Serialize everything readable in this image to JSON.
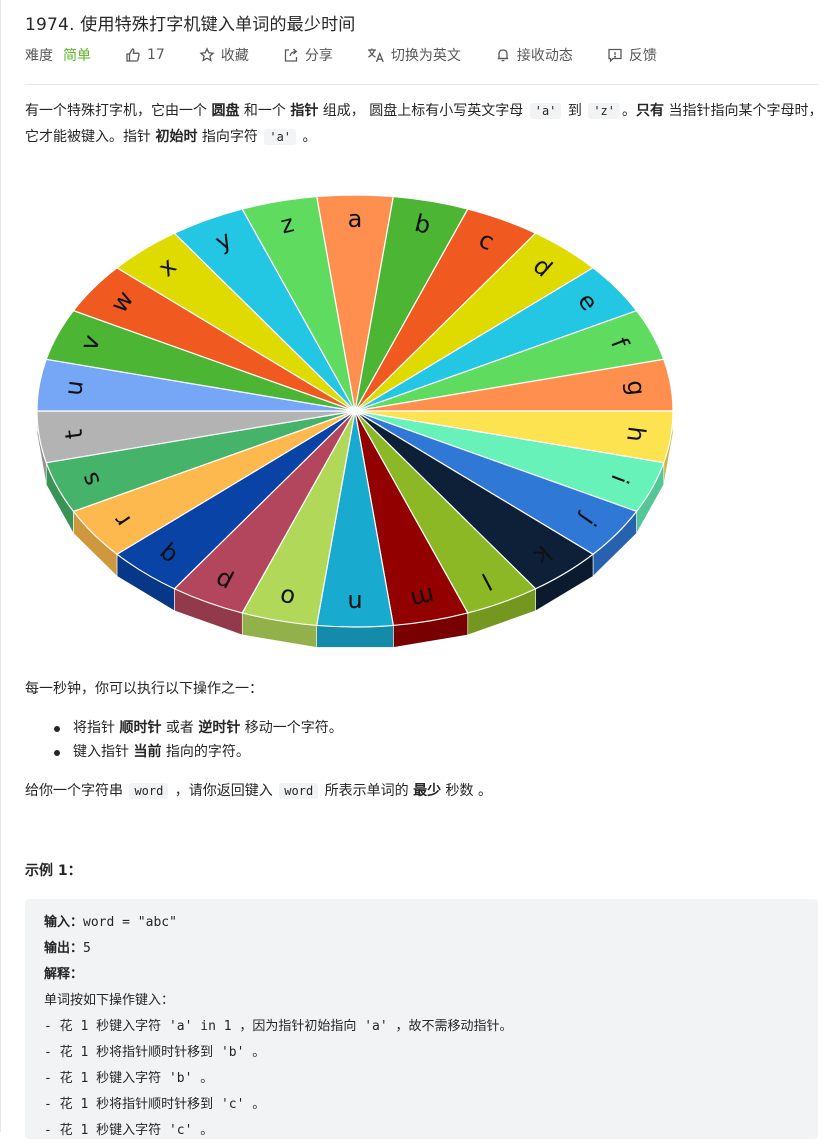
{
  "problem": {
    "title": "1974. 使用特殊打字机键入单词的最少时间",
    "difficulty_label": "难度",
    "difficulty_value": "简单",
    "likes": "17",
    "actions": {
      "favorite": "收藏",
      "share": "分享",
      "translate": "切换为英文",
      "notify": "接收动态",
      "feedback": "反馈"
    }
  },
  "description": {
    "p1": [
      {
        "t": "text",
        "v": "有一个特殊打字机，它由一个 "
      },
      {
        "t": "bold",
        "v": "圆盘"
      },
      {
        "t": "text",
        "v": " 和一个 "
      },
      {
        "t": "bold",
        "v": "指针"
      },
      {
        "t": "text",
        "v": " 组成， 圆盘上标有小写英文字母 "
      },
      {
        "t": "code",
        "v": "'a'"
      },
      {
        "t": "text",
        "v": " 到 "
      },
      {
        "t": "code",
        "v": "'z'"
      },
      {
        "t": "text",
        "v": "。"
      },
      {
        "t": "bold",
        "v": "只有"
      },
      {
        "t": "text",
        "v": " 当指针指向某个字母时，它才能被键入。指针 "
      },
      {
        "t": "bold",
        "v": "初始时"
      },
      {
        "t": "text",
        "v": " 指向字符 "
      },
      {
        "t": "code",
        "v": "'a'"
      },
      {
        "t": "text",
        "v": " 。"
      }
    ],
    "ops_intro": "每一秒钟，你可以执行以下操作之一：",
    "ops": [
      [
        {
          "t": "text",
          "v": "将指针 "
        },
        {
          "t": "bold",
          "v": "顺时针"
        },
        {
          "t": "text",
          "v": " 或者 "
        },
        {
          "t": "bold",
          "v": "逆时针"
        },
        {
          "t": "text",
          "v": " 移动一个字符。"
        }
      ],
      [
        {
          "t": "text",
          "v": "键入指针 "
        },
        {
          "t": "bold",
          "v": "当前"
        },
        {
          "t": "text",
          "v": " 指向的字符。"
        }
      ]
    ],
    "give": [
      {
        "t": "text",
        "v": "给你一个字符串 "
      },
      {
        "t": "code",
        "v": "word"
      },
      {
        "t": "text",
        "v": " ，请你返回键入 "
      },
      {
        "t": "code",
        "v": "word"
      },
      {
        "t": "text",
        "v": " 所表示单词的 "
      },
      {
        "t": "bold",
        "v": "最少"
      },
      {
        "t": "text",
        "v": " 秒数 。"
      }
    ]
  },
  "wheel": {
    "letters": [
      "a",
      "b",
      "c",
      "d",
      "e",
      "f",
      "g",
      "h",
      "i",
      "j",
      "k",
      "l",
      "m",
      "n",
      "o",
      "p",
      "q",
      "r",
      "s",
      "t",
      "u",
      "v",
      "w",
      "x",
      "y",
      "z"
    ],
    "colors": [
      "#fe8f4e",
      "#4cb534",
      "#f05a21",
      "#dfdb00",
      "#24c7e3",
      "#5fdc5f",
      "#fe8f4e",
      "#fde34f",
      "#67f2b9",
      "#2f78d5",
      "#0d2038",
      "#8cb826",
      "#920000",
      "#18aacf",
      "#b2d85a",
      "#b3455d",
      "#0843a5",
      "#fdb94d",
      "#45b36a",
      "#b3b3b3",
      "#76a7f6",
      "#4cb534",
      "#f05a21",
      "#dfdb00",
      "#24c7e3",
      "#5fdc5f"
    ]
  },
  "example": {
    "title": "示例 1：",
    "input_label": "输入：",
    "input_value": "word = \"abc\"",
    "output_label": "输出：",
    "output_value": "5",
    "explain_label": "解释：",
    "lines": [
      "单词按如下操作键入：",
      "- 花 1 秒键入字符 'a' in 1 ，因为指针初始指向 'a' ，故不需移动指针。",
      "- 花 1 秒将指针顺时针移到 'b' 。",
      "- 花 1 秒键入字符 'b' 。",
      "- 花 1 秒将指针顺时针移到 'c' 。",
      "- 花 1 秒键入字符 'c' 。"
    ]
  }
}
